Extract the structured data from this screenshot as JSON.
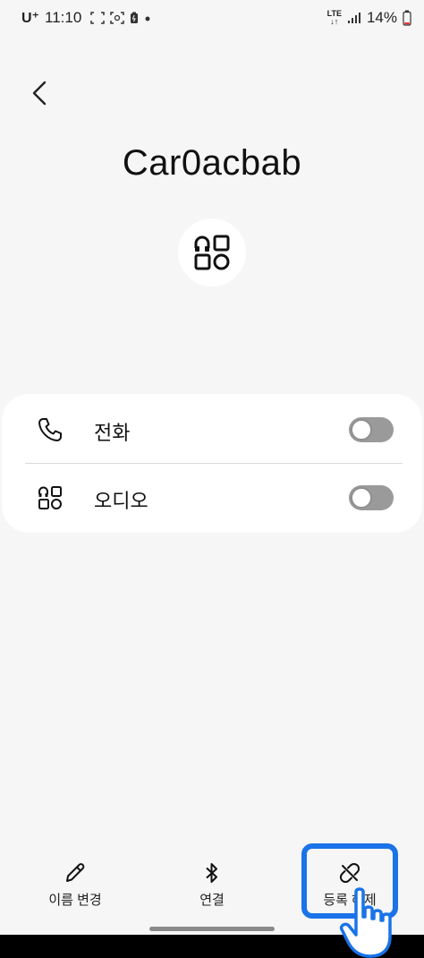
{
  "status_bar": {
    "carrier": "U⁺",
    "time": "11:10",
    "network": "LTE",
    "battery": "14%"
  },
  "device": {
    "name": "Car0acbab"
  },
  "profiles": [
    {
      "label": "전화",
      "icon": "phone-icon",
      "enabled": false
    },
    {
      "label": "오디오",
      "icon": "audio-apps-icon",
      "enabled": false
    }
  ],
  "bottom_actions": [
    {
      "label": "이름 변경",
      "icon": "pencil-icon"
    },
    {
      "label": "연결",
      "icon": "bluetooth-icon"
    },
    {
      "label": "등록 해제",
      "icon": "unlink-icon"
    }
  ],
  "colors": {
    "background": "#f6f6f6",
    "card": "#ffffff",
    "toggle_off": "#9a9a9a",
    "highlight": "#1a73e8"
  }
}
